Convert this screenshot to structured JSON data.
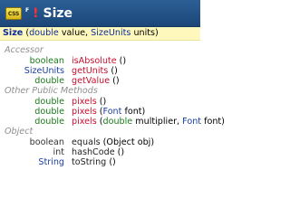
{
  "header": {
    "badge": "CSS",
    "final": "F",
    "bang": "!",
    "title": "Size"
  },
  "ctor": {
    "name": "Size",
    "open": " (",
    "p1_type": "double",
    "p1_name": " value, ",
    "p2_type": "SizeUnits",
    "p2_name": " units",
    "close": ")"
  },
  "sections": {
    "accessor": "Accessor",
    "other": "Other Public Methods",
    "object": "Object"
  },
  "rows": {
    "is_absolute": {
      "ret": "boolean",
      "name": "isAbsolute",
      "args": " ()"
    },
    "get_units": {
      "ret": "SizeUnits",
      "name": "getUnits",
      "args": " ()"
    },
    "get_value": {
      "ret": "double",
      "name": "getValue",
      "args": " ()"
    },
    "pixels0": {
      "ret": "double",
      "name": "pixels",
      "args": " ()"
    },
    "pixels1": {
      "ret": "double",
      "name": "pixels",
      "a1": " (",
      "t1": "Font",
      "a2": " font)"
    },
    "pixels2": {
      "ret": "double",
      "name": "pixels",
      "a1": " (",
      "t1": "double",
      "a2": " multiplier, ",
      "t2": "Font",
      "a3": " font)"
    },
    "equals": {
      "ret": "boolean",
      "name": "equals",
      "a1": " (Object obj)"
    },
    "hash": {
      "ret": "int",
      "name": "hashCode",
      "args": " ()"
    },
    "tostr": {
      "ret": "String",
      "name": "toString",
      "args": " ()"
    }
  }
}
